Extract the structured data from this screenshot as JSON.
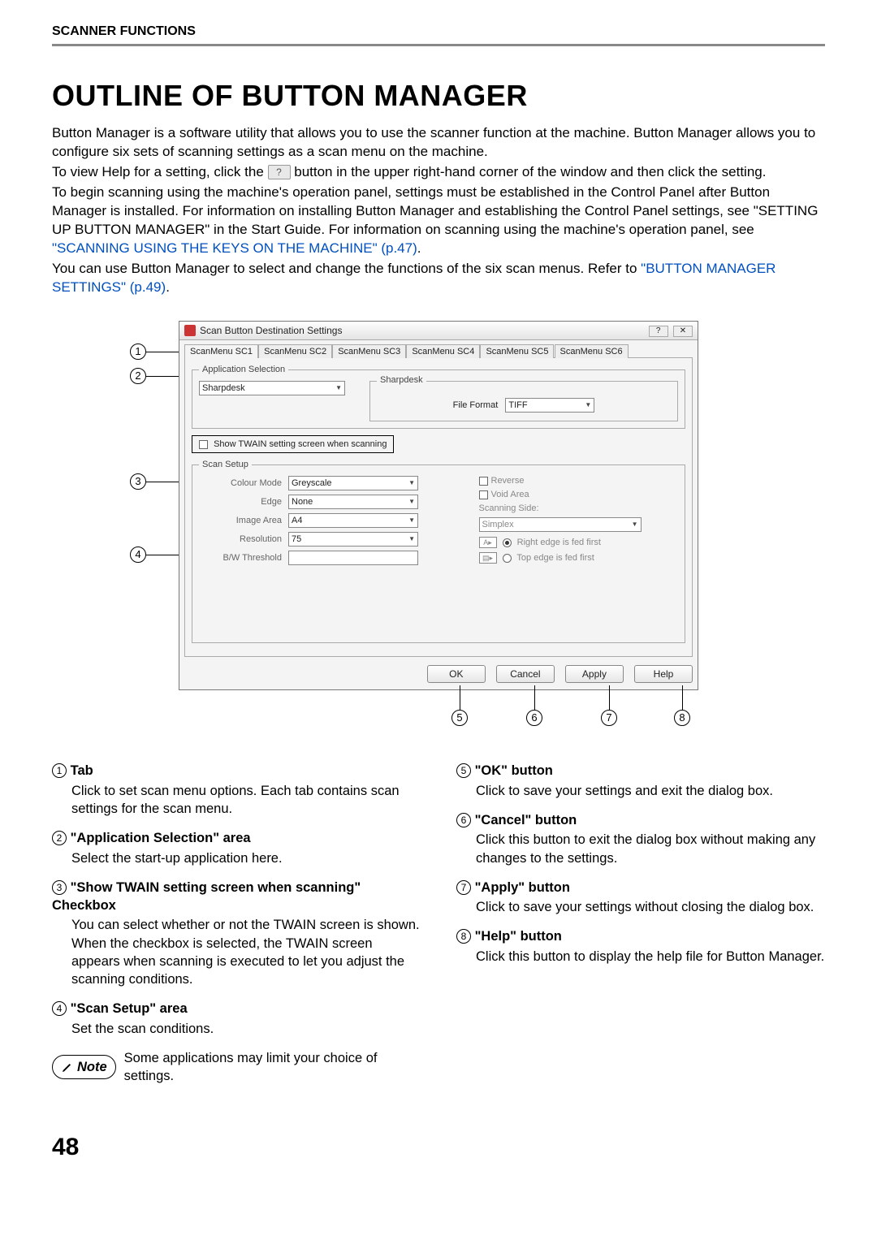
{
  "header_section": "SCANNER FUNCTIONS",
  "title": "OUTLINE OF BUTTON MANAGER",
  "page_number": "48",
  "intro": {
    "p1": "Button Manager is a software utility that allows you to use the scanner function at the machine. Button Manager allows you to configure six sets of scanning settings as a scan menu on the machine.",
    "p2a": "To view Help for a setting, click the ",
    "p2b": " button in the upper right-hand corner of the window and then click the setting.",
    "p3a": "To begin scanning using the machine's operation panel, settings must be established in the Control Panel after Button Manager is installed. For information on installing Button Manager and establishing the Control Panel settings, see \"SETTING UP BUTTON MANAGER\" in the Start Guide. For information on scanning using the machine's operation panel, see ",
    "link1": "\"SCANNING USING THE KEYS ON THE MACHINE\" (p.47)",
    "p3b": ".",
    "p4a": "You can use Button Manager to select and change the functions of the six scan menus. Refer to ",
    "link2": "\"BUTTON MANAGER SETTINGS\" (p.49)",
    "p4b": "."
  },
  "callouts": {
    "c1": "1",
    "c2": "2",
    "c3": "3",
    "c4": "4",
    "c5": "5",
    "c6": "6",
    "c7": "7",
    "c8": "8"
  },
  "window": {
    "title": "Scan Button Destination Settings",
    "help_glyph": "?",
    "close_glyph": "✕",
    "tabs": [
      "ScanMenu SC1",
      "ScanMenu SC2",
      "ScanMenu SC3",
      "ScanMenu SC4",
      "ScanMenu SC5",
      "ScanMenu SC6"
    ],
    "app_selection_legend": "Application Selection",
    "app_selected": "Sharpdesk",
    "app_inner_legend": "Sharpdesk",
    "file_format_label": "File Format",
    "file_format_value": "TIFF",
    "twain_label": "Show TWAIN setting screen when scanning",
    "scan_setup_legend": "Scan Setup",
    "colour_mode_label": "Colour Mode",
    "colour_mode_value": "Greyscale",
    "edge_label": "Edge",
    "edge_value": "None",
    "image_area_label": "Image Area",
    "image_area_value": "A4",
    "resolution_label": "Resolution",
    "resolution_value": "75",
    "bw_label": "B/W Threshold",
    "reverse_label": "Reverse",
    "void_label": "Void Area",
    "side_label": "Scanning Side:",
    "side_value": "Simplex",
    "feed_a": "A▸",
    "feed_b": "▤▸",
    "feed_a_label": "Right edge is fed first",
    "feed_b_label": "Top edge is fed first",
    "btn_ok": "OK",
    "btn_cancel": "Cancel",
    "btn_apply": "Apply",
    "btn_help": "Help"
  },
  "items_left": [
    {
      "n": "1",
      "t": "Tab",
      "b": "Click to set scan menu options. Each tab contains scan settings for the scan menu."
    },
    {
      "n": "2",
      "t": "\"Application Selection\" area",
      "b": "Select the start-up application here."
    },
    {
      "n": "3",
      "t": "\"Show TWAIN setting screen when scanning\" Checkbox",
      "b": "You can select whether or not the TWAIN screen is shown. When the checkbox is selected, the TWAIN screen appears when scanning is executed to let you adjust the scanning conditions."
    },
    {
      "n": "4",
      "t": "\"Scan Setup\" area",
      "b": "Set the scan conditions."
    }
  ],
  "note": {
    "label": "Note",
    "text": "Some applications may limit your choice of settings."
  },
  "items_right": [
    {
      "n": "5",
      "t": "\"OK\" button",
      "b": "Click to save your settings and exit the dialog box."
    },
    {
      "n": "6",
      "t": "\"Cancel\" button",
      "b": "Click this button to exit the dialog box without making any changes to the settings."
    },
    {
      "n": "7",
      "t": "\"Apply\" button",
      "b": "Click to save your settings without closing the dialog box."
    },
    {
      "n": "8",
      "t": "\"Help\" button",
      "b": "Click this button to display the help file for Button Manager."
    }
  ]
}
